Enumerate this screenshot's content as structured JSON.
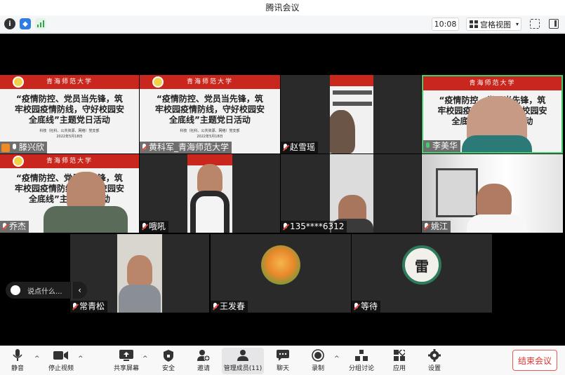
{
  "window": {
    "title": "腾讯会议"
  },
  "topbar": {
    "time": "10:08",
    "view_label": "宫格视图"
  },
  "slide": {
    "header": "青海师范大学",
    "line1": "“疫情防控、党员当先锋，筑",
    "line2": "牢校园疫情防线，守好校园安",
    "line3": "全底线”主题党日活动",
    "sub1": "科技（社科、公共资源、网络）党支部",
    "sub2": "2022年5月18日"
  },
  "participants": [
    {
      "name": "滕兴欣"
    },
    {
      "name": "黄科军_青海师范大学"
    },
    {
      "name": "赵雪瑶"
    },
    {
      "name": "李美华"
    },
    {
      "name": "乔杰"
    },
    {
      "name": "哦吼"
    },
    {
      "name": "135****6312"
    },
    {
      "name": "姚江"
    },
    {
      "name": "常青松"
    },
    {
      "name": "王发春"
    },
    {
      "name": "等待"
    }
  ],
  "chat": {
    "placeholder": "说点什么..."
  },
  "toolbar": {
    "mute": "静音",
    "stop_video": "停止视频",
    "share": "共享屏幕",
    "security": "安全",
    "invite": "邀请",
    "members": "管理成员(11)",
    "chat": "聊天",
    "record": "录制",
    "breakout": "分组讨论",
    "apps": "应用",
    "settings": "设置",
    "end": "结束会议"
  },
  "avatar_text": "雷",
  "colors": {
    "accent": "#1a73e8",
    "end": "#e0332d",
    "slide_header": "#c9271d",
    "active_border": "#3fd06a"
  }
}
